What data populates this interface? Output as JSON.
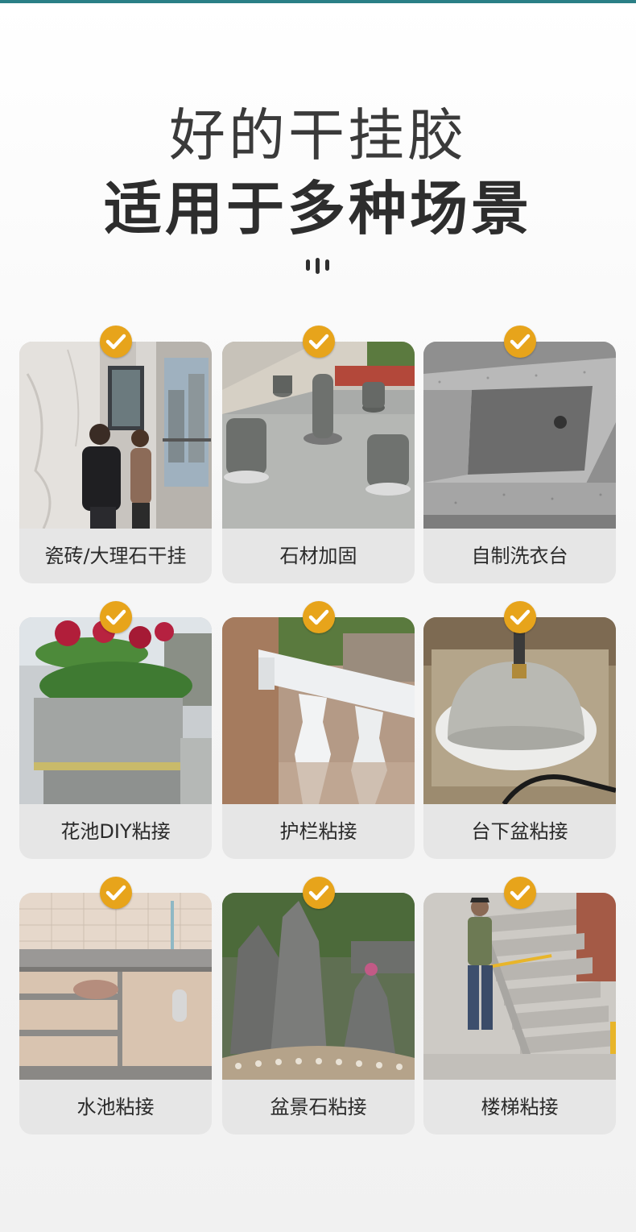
{
  "header": {
    "line1": "好的干挂胶",
    "line2": "适用于多种场景"
  },
  "colors": {
    "accent_top_bar": "#2b7f86",
    "check_badge": "#e7a41b",
    "card_background": "#e6e6e6"
  },
  "badge_icon": "check-icon",
  "scenes": [
    {
      "label": "瓷砖/大理石干挂",
      "photo": "workers-hanging-marble-wall"
    },
    {
      "label": "石材加固",
      "photo": "stone-pillars-on-rooftop"
    },
    {
      "label": "自制洗衣台",
      "photo": "granite-laundry-sink"
    },
    {
      "label": "花池DIY粘接",
      "photo": "granite-flower-planter"
    },
    {
      "label": "护栏粘接",
      "photo": "marble-balustrade"
    },
    {
      "label": "台下盆粘接",
      "photo": "undermount-basin-gluing"
    },
    {
      "label": "水池粘接",
      "photo": "granite-kitchen-counter"
    },
    {
      "label": "盆景石粘接",
      "photo": "rockery-bonsai-stones"
    },
    {
      "label": "楼梯粘接",
      "photo": "granite-staircase-worker"
    }
  ]
}
